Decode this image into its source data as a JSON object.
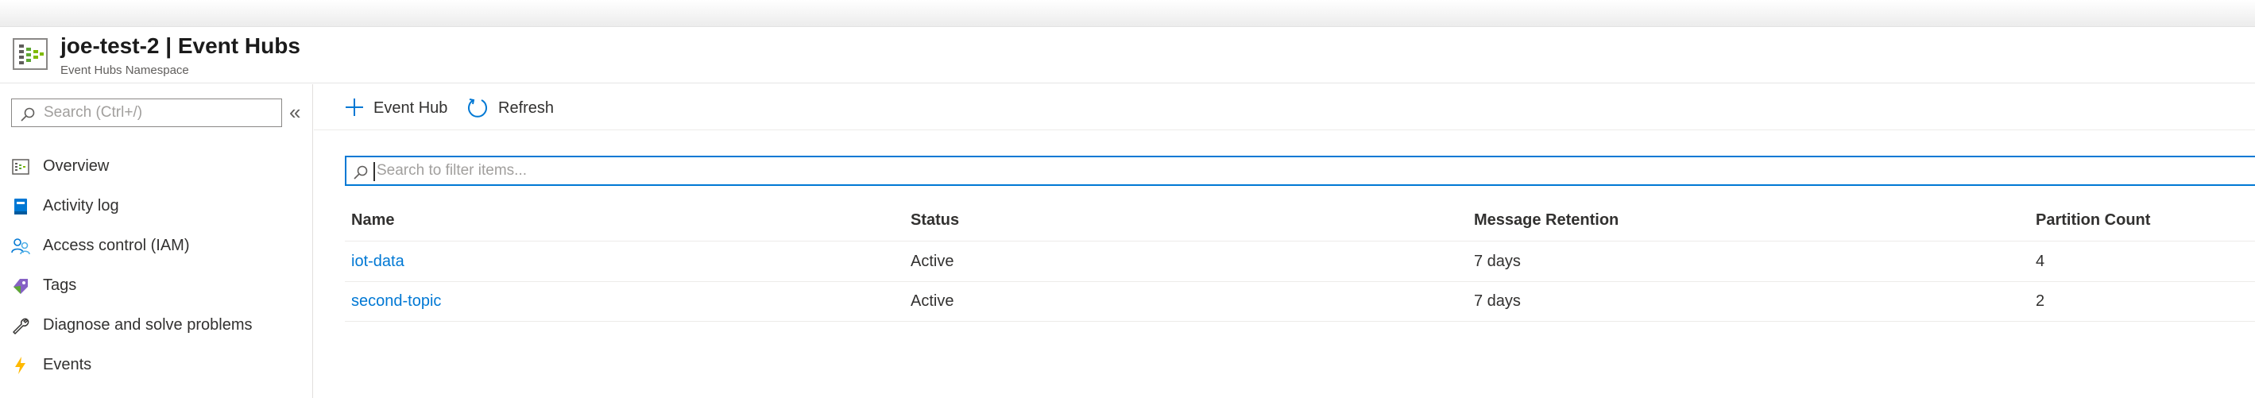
{
  "header": {
    "title": "joe-test-2 | Event Hubs",
    "subtitle": "Event Hubs Namespace",
    "icon": "event-hubs-namespace-icon"
  },
  "sidebar": {
    "search_placeholder": "Search (Ctrl+/)",
    "collapse_glyph": "«",
    "items": [
      {
        "label": "Overview",
        "icon": "overview-icon"
      },
      {
        "label": "Activity log",
        "icon": "activity-log-icon"
      },
      {
        "label": "Access control (IAM)",
        "icon": "iam-icon"
      },
      {
        "label": "Tags",
        "icon": "tag-icon"
      },
      {
        "label": "Diagnose and solve problems",
        "icon": "wrench-icon"
      },
      {
        "label": "Events",
        "icon": "lightning-icon"
      }
    ]
  },
  "toolbar": {
    "add_label": "Event Hub",
    "refresh_label": "Refresh"
  },
  "filter": {
    "placeholder": "Search to filter items..."
  },
  "table": {
    "columns": [
      "Name",
      "Status",
      "Message Retention",
      "Partition Count"
    ],
    "rows": [
      {
        "name": "iot-data",
        "status": "Active",
        "retention": "7 days",
        "partitions": "4"
      },
      {
        "name": "second-topic",
        "status": "Active",
        "retention": "7 days",
        "partitions": "2"
      }
    ]
  },
  "colors": {
    "accent": "#0078d4",
    "text": "#323130",
    "border": "#8a8886"
  }
}
